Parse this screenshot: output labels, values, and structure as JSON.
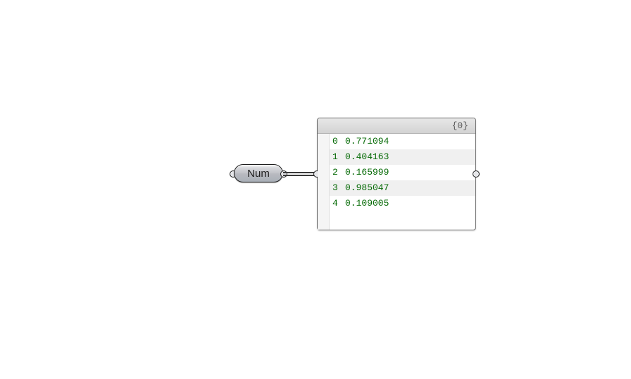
{
  "num_node": {
    "label": "Num"
  },
  "panel": {
    "path_label": "{0}",
    "items": [
      {
        "index": "0",
        "value": "0.771094"
      },
      {
        "index": "1",
        "value": "0.404163"
      },
      {
        "index": "2",
        "value": "0.165999"
      },
      {
        "index": "3",
        "value": "0.985047"
      },
      {
        "index": "4",
        "value": "0.109005"
      }
    ]
  }
}
